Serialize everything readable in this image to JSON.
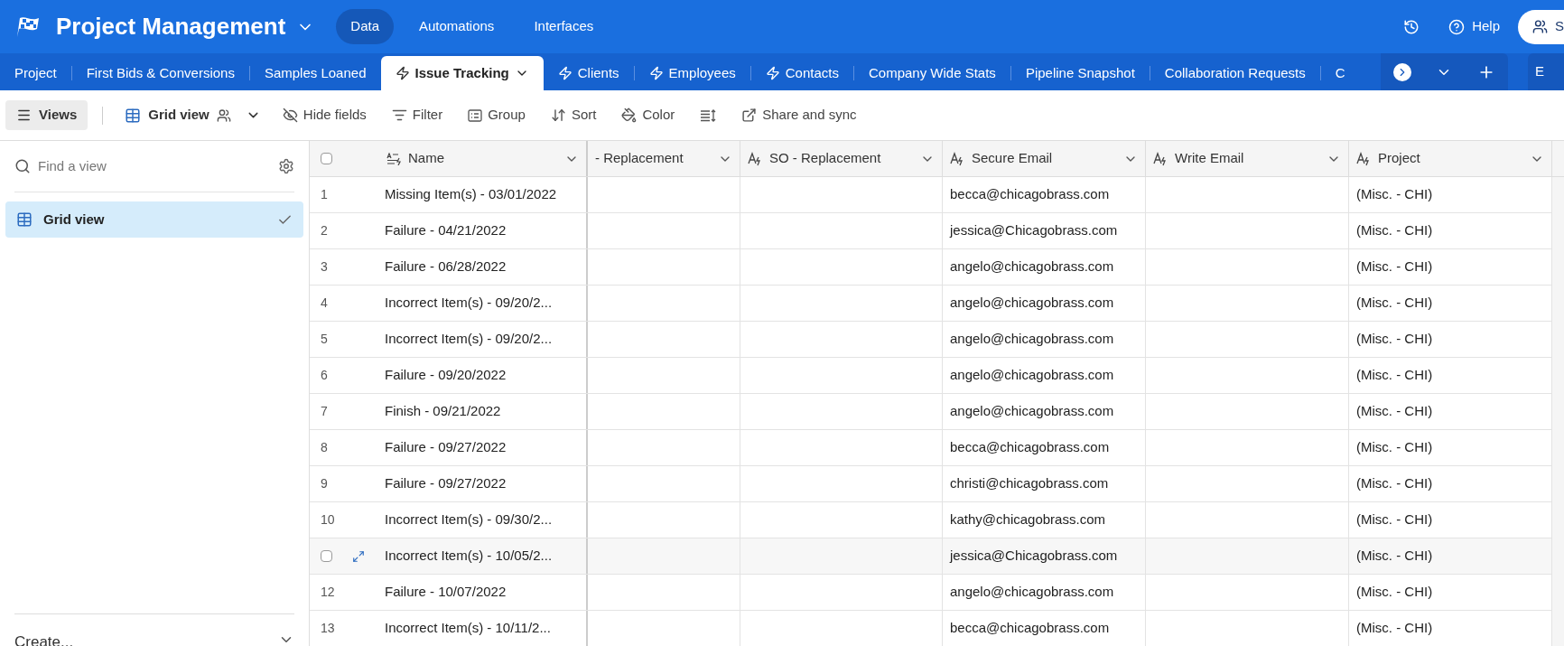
{
  "header": {
    "title": "Project Management",
    "nav": [
      {
        "label": "Data",
        "selected": true
      },
      {
        "label": "Automations",
        "selected": false
      },
      {
        "label": "Interfaces",
        "selected": false
      }
    ],
    "help": "Help",
    "share": "S"
  },
  "tabs": [
    {
      "label": "Project",
      "kind": "plain",
      "selected": false
    },
    {
      "label": "First Bids & Conversions",
      "kind": "plain",
      "selected": false
    },
    {
      "label": "Samples Loaned",
      "kind": "plain",
      "selected": false
    },
    {
      "label": "Issue Tracking",
      "kind": "synced",
      "selected": true
    },
    {
      "label": "Clients",
      "kind": "synced",
      "selected": false
    },
    {
      "label": "Employees",
      "kind": "synced",
      "selected": false
    },
    {
      "label": "Contacts",
      "kind": "synced",
      "selected": false
    },
    {
      "label": "Company Wide Stats",
      "kind": "plain",
      "selected": false
    },
    {
      "label": "Pipeline Snapshot",
      "kind": "plain",
      "selected": false
    },
    {
      "label": "Collaboration Requests",
      "kind": "plain",
      "selected": false
    },
    {
      "label": "C",
      "kind": "plain",
      "selected": false
    }
  ],
  "extra_tab": "E",
  "toolbar": {
    "views": "Views",
    "view_name": "Grid view",
    "items": [
      {
        "kind": "hide",
        "label": "Hide fields"
      },
      {
        "kind": "filter",
        "label": "Filter"
      },
      {
        "kind": "group",
        "label": "Group"
      },
      {
        "kind": "sort",
        "label": "Sort"
      },
      {
        "kind": "color",
        "label": "Color"
      },
      {
        "kind": "height"
      },
      {
        "kind": "share",
        "label": "Share and sync"
      }
    ]
  },
  "sidebar": {
    "search_placeholder": "Find a view",
    "views": [
      {
        "label": "Grid view",
        "selected": true
      }
    ],
    "create": "Create..."
  },
  "table": {
    "select_all_checked": false,
    "columns": [
      {
        "label": "Name",
        "kind": "primary"
      },
      {
        "label": "- Replacement",
        "kind": "cut"
      },
      {
        "label": "SO - Replacement",
        "kind": "formula"
      },
      {
        "label": "Secure Email",
        "kind": "formula"
      },
      {
        "label": "Write Email",
        "kind": "formula"
      },
      {
        "label": "Project",
        "kind": "formula"
      }
    ],
    "rows": [
      {
        "number": "1",
        "hovered": false,
        "cells": [
          "Missing Item(s) - 03/01/2022",
          "",
          "",
          "becca@chicagobrass.com",
          "",
          "(Misc. - CHI)"
        ]
      },
      {
        "number": "2",
        "hovered": false,
        "cells": [
          "Failure - 04/21/2022",
          "",
          "",
          "jessica@Chicagobrass.com",
          "",
          "(Misc. - CHI)"
        ]
      },
      {
        "number": "3",
        "hovered": false,
        "cells": [
          "Failure - 06/28/2022",
          "",
          "",
          "angelo@chicagobrass.com",
          "",
          "(Misc. - CHI)"
        ]
      },
      {
        "number": "4",
        "hovered": false,
        "cells": [
          "Incorrect Item(s) - 09/20/2...",
          "",
          "",
          "angelo@chicagobrass.com",
          "",
          "(Misc. - CHI)"
        ]
      },
      {
        "number": "5",
        "hovered": false,
        "cells": [
          "Incorrect Item(s) - 09/20/2...",
          "",
          "",
          "angelo@chicagobrass.com",
          "",
          "(Misc. - CHI)"
        ]
      },
      {
        "number": "6",
        "hovered": false,
        "cells": [
          "Failure - 09/20/2022",
          "",
          "",
          "angelo@chicagobrass.com",
          "",
          "(Misc. - CHI)"
        ]
      },
      {
        "number": "7",
        "hovered": false,
        "cells": [
          "Finish - 09/21/2022",
          "",
          "",
          "angelo@chicagobrass.com",
          "",
          "(Misc. - CHI)"
        ]
      },
      {
        "number": "8",
        "hovered": false,
        "cells": [
          "Failure - 09/27/2022",
          "",
          "",
          "becca@chicagobrass.com",
          "",
          "(Misc. - CHI)"
        ]
      },
      {
        "number": "9",
        "hovered": false,
        "cells": [
          "Failure - 09/27/2022",
          "",
          "",
          "christi@chicagobrass.com",
          "",
          "(Misc. - CHI)"
        ]
      },
      {
        "number": "10",
        "hovered": false,
        "cells": [
          "Incorrect Item(s) - 09/30/2...",
          "",
          "",
          "kathy@chicagobrass.com",
          "",
          "(Misc. - CHI)"
        ]
      },
      {
        "hovered": true,
        "cells": [
          "Incorrect Item(s) - 10/05/2...",
          "",
          "",
          "jessica@Chicagobrass.com",
          "",
          "(Misc. - CHI)"
        ]
      },
      {
        "number": "12",
        "hovered": false,
        "cells": [
          "Failure - 10/07/2022",
          "",
          "",
          "angelo@chicagobrass.com",
          "",
          "(Misc. - CHI)"
        ]
      },
      {
        "number": "13",
        "hovered": false,
        "cells": [
          "Incorrect Item(s) - 10/11/2...",
          "",
          "",
          "becca@chicagobrass.com",
          "",
          "(Misc. - CHI)"
        ]
      }
    ]
  }
}
